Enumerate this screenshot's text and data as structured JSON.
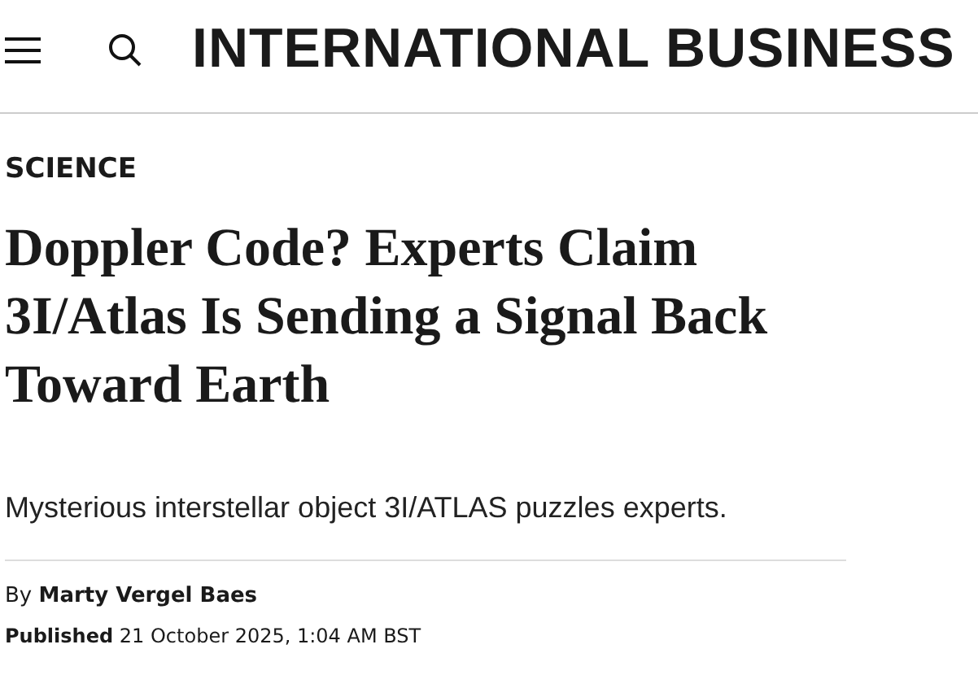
{
  "header": {
    "logo": "INTERNATIONAL BUSINESS"
  },
  "article": {
    "section": "SCIENCE",
    "headline": "Doppler Code? Experts Claim 3I/Atlas Is Sending a Signal Back Toward Earth",
    "summary": "Mysterious interstellar object 3I/ATLAS puzzles experts.",
    "byline_prefix": "By",
    "author": "Marty Vergel Baes",
    "published_label": "Published",
    "published_date": "21 October 2025, 1:04 AM BST"
  }
}
